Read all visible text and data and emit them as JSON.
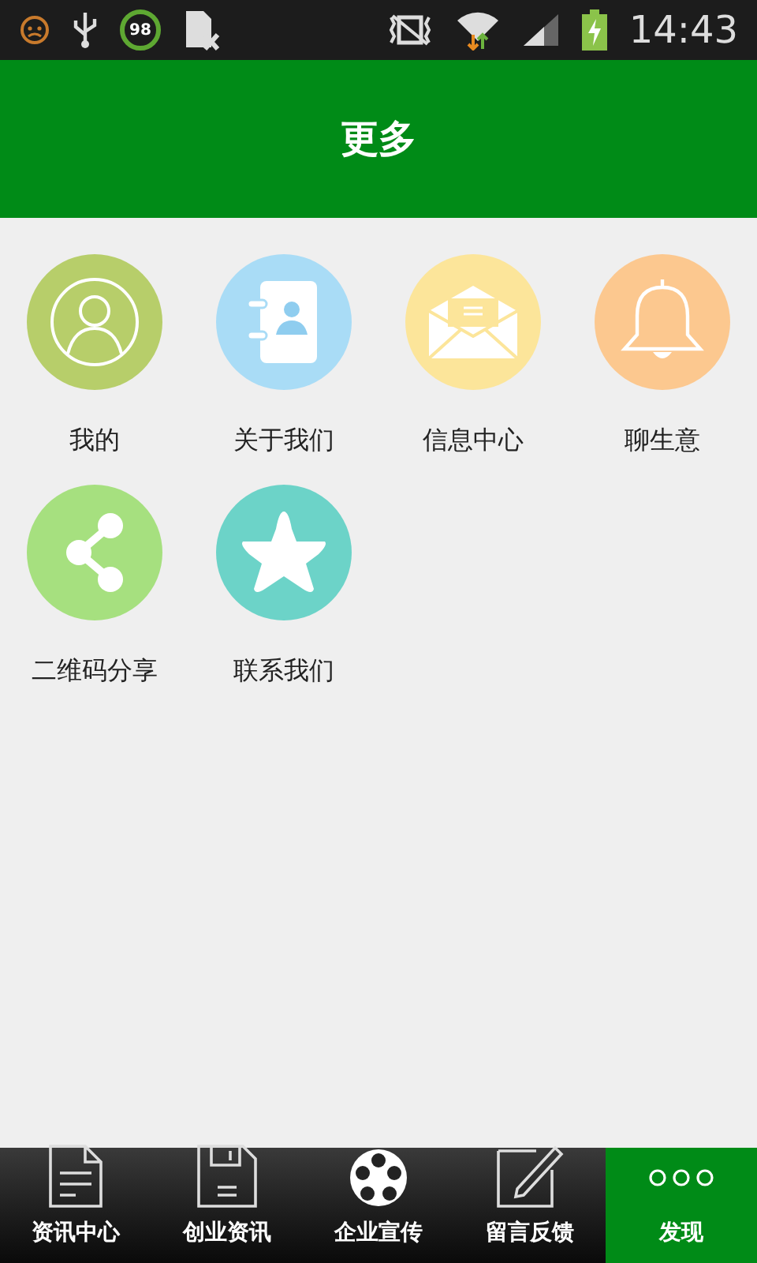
{
  "status_bar": {
    "badge": "98",
    "time": "14:43"
  },
  "header": {
    "title": "更多"
  },
  "items": [
    {
      "label": "我的"
    },
    {
      "label": "关于我们"
    },
    {
      "label": "信息中心"
    },
    {
      "label": "聊生意"
    },
    {
      "label": "二维码分享"
    },
    {
      "label": "联系我们"
    }
  ],
  "tabs": [
    {
      "label": "资讯中心",
      "selected": false
    },
    {
      "label": "创业资讯",
      "selected": false
    },
    {
      "label": "企业宣传",
      "selected": false
    },
    {
      "label": "留言反馈",
      "selected": false
    },
    {
      "label": "发现",
      "selected": true
    }
  ]
}
